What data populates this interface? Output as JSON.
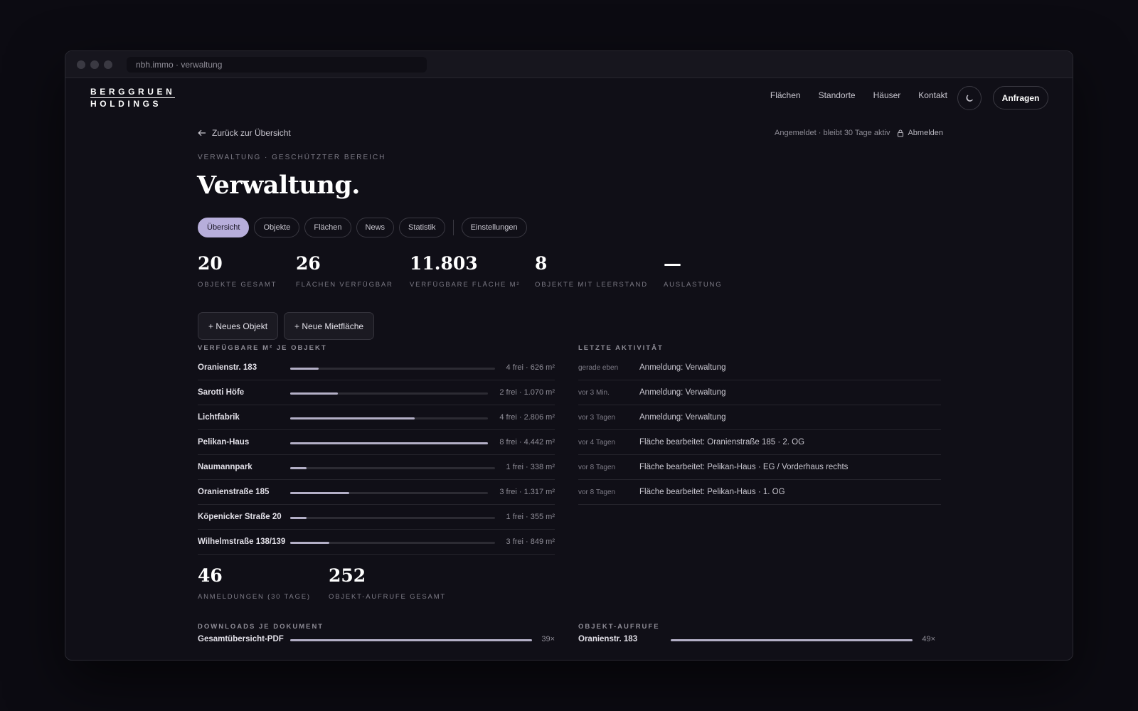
{
  "browser": {
    "url": "nbh.immo · verwaltung"
  },
  "brand": {
    "line1": "BERGGRUEN",
    "line2": "HOLDINGS"
  },
  "nav": [
    {
      "label": "Flächen"
    },
    {
      "label": "Standorte"
    },
    {
      "label": "Häuser"
    },
    {
      "label": "Kontakt"
    }
  ],
  "header": {
    "theme_icon": "moon-icon",
    "cta_label": "Anfragen"
  },
  "back": {
    "label": "Zurück zur Übersicht"
  },
  "session": {
    "status": "Angemeldet · bleibt 30 Tage aktiv",
    "logout_label": "Abmelden"
  },
  "eyebrow": "VERWALTUNG · GESCHÜTZTER BEREICH",
  "title": "Verwaltung.",
  "tabs": [
    {
      "label": "Übersicht",
      "active": true
    },
    {
      "label": "Objekte"
    },
    {
      "label": "Flächen"
    },
    {
      "label": "News"
    },
    {
      "label": "Statistik"
    },
    {
      "label": "Einstellungen"
    }
  ],
  "stats": [
    {
      "value": "20",
      "label": "OBJEKTE GESAMT"
    },
    {
      "value": "26",
      "label": "FLÄCHEN VERFÜGBAR"
    },
    {
      "value": "11.803",
      "label": "VERFÜGBARE FLÄCHE M²"
    },
    {
      "value": "8",
      "label": "OBJEKTE MIT LEERSTAND"
    },
    {
      "value": "—",
      "label": "AUSLASTUNG"
    }
  ],
  "actions": {
    "new_object": "+ Neues Objekt",
    "new_space": "+ Neue Mietfläche"
  },
  "availability": {
    "heading": "VERFÜGBARE M² JE OBJEKT",
    "rows": [
      {
        "name": "Oranienstr. 183",
        "meta": "4 frei · 626 m²",
        "share": 0.14
      },
      {
        "name": "Sarotti Höfe",
        "meta": "2 frei · 1.070 m²",
        "share": 0.24
      },
      {
        "name": "Lichtfabrik",
        "meta": "4 frei · 2.806 m²",
        "share": 0.63
      },
      {
        "name": "Pelikan-Haus",
        "meta": "8 frei · 4.442 m²",
        "share": 1.0
      },
      {
        "name": "Naumannpark",
        "meta": "1 frei · 338 m²",
        "share": 0.08
      },
      {
        "name": "Oranienstraße 185",
        "meta": "3 frei · 1.317 m²",
        "share": 0.3
      },
      {
        "name": "Köpenicker Straße 20",
        "meta": "1 frei · 355 m²",
        "share": 0.08
      },
      {
        "name": "Wilhelmstraße 138/139",
        "meta": "3 frei · 849 m²",
        "share": 0.19
      }
    ]
  },
  "activity": {
    "heading": "LETZTE AKTIVITÄT",
    "rows": [
      {
        "time": "gerade eben",
        "text": "Anmeldung: Verwaltung"
      },
      {
        "time": "vor 3 Min.",
        "text": "Anmeldung: Verwaltung"
      },
      {
        "time": "vor 3 Tagen",
        "text": "Anmeldung: Verwaltung"
      },
      {
        "time": "vor 4 Tagen",
        "text": "Fläche bearbeitet: Oranienstraße 185 · 2. OG"
      },
      {
        "time": "vor 8 Tagen",
        "text": "Fläche bearbeitet: Pelikan-Haus · EG / Vorderhaus rechts"
      },
      {
        "time": "vor 8 Tagen",
        "text": "Fläche bearbeitet: Pelikan-Haus · 1. OG"
      }
    ]
  },
  "stats2": [
    {
      "value": "46",
      "label": "ANMELDUNGEN (30 TAGE)"
    },
    {
      "value": "252",
      "label": "OBJEKT-AUFRUFE GESAMT"
    }
  ],
  "downloads": {
    "heading": "DOWNLOADS JE DOKUMENT",
    "rows": [
      {
        "name": "Gesamtübersicht-PDF",
        "count": "39×",
        "share": 1.0
      }
    ]
  },
  "object_views": {
    "heading": "OBJEKT-AUFRUFE",
    "rows": [
      {
        "name": "Oranienstr. 183",
        "count": "49×",
        "share": 1.0
      }
    ]
  },
  "colors": {
    "accent": "#b7aedb",
    "bar": "#b3afc6",
    "background": "#0c0b12"
  }
}
